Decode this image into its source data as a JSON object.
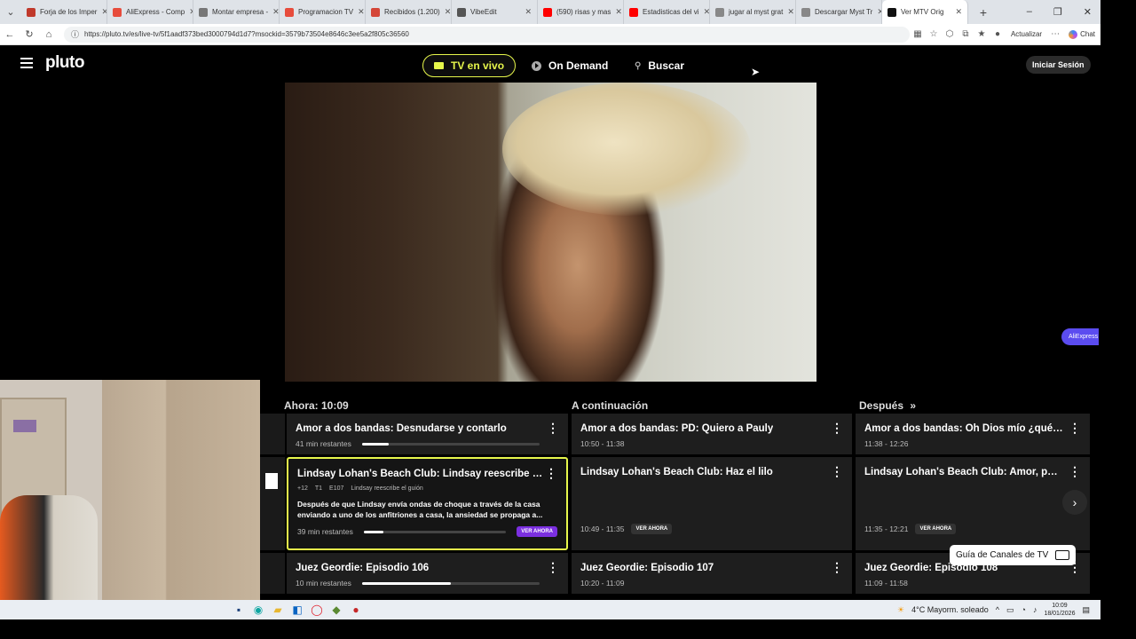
{
  "browser": {
    "tabs": [
      {
        "title": "Forja de los Imper",
        "color": "#c0392b"
      },
      {
        "title": "AliExpress - Comp",
        "color": "#e74c3c"
      },
      {
        "title": "Montar empresa -",
        "color": "#777777"
      },
      {
        "title": "Programacion TV",
        "color": "#e74c3c"
      },
      {
        "title": "Recibidos (1.200)",
        "color": "#d44638"
      },
      {
        "title": "VibeEdit",
        "color": "#555555"
      },
      {
        "title": "(590) risas y mas",
        "color": "#ff0000"
      },
      {
        "title": "Estadisticas del vi",
        "color": "#ff0000"
      },
      {
        "title": "jugar al myst grat",
        "color": "#888888"
      },
      {
        "title": "Descargar Myst Tr",
        "color": "#888888"
      },
      {
        "title": "Ver MTV Orig",
        "color": "#111111"
      }
    ],
    "new_tab": "+",
    "url": "https://pluto.tv/es/live-tv/5f1aadf373bed3000794d1d7?msockid=3579b73504e8646c3ee5a2f805c36560",
    "update_label": "Actualizar",
    "chat_label": "Chat"
  },
  "pluto": {
    "logo": "pluto",
    "nav": {
      "live_tv": "TV en vivo",
      "on_demand": "On Demand",
      "search": "Buscar"
    },
    "login": "Iniciar Sesión",
    "aliexpress_badge": "AliExpress",
    "guide": {
      "now_header": "Ahora: 10:09",
      "next_header": "A continuación",
      "later_header": "Después",
      "rows": [
        {
          "now": {
            "title": "Amor a dos bandas: Desnudarse y contarlo",
            "remaining": "41 min restantes",
            "progress": 0.15
          },
          "next": {
            "title": "Amor a dos bandas: PD: Quiero a Pauly",
            "time": "10:50 - 11:38"
          },
          "later": {
            "title": "Amor a dos bandas: Oh Dios mío ¿qué le ...",
            "time": "11:38 - 12:26"
          }
        },
        {
          "now": {
            "title": "Lindsay Lohan's Beach Club: Lindsay reescribe el...",
            "meta": [
              "+12",
              "T1",
              "E107",
              "Lindsay reescribe el guión"
            ],
            "desc": "Después de que Lindsay envía ondas de choque a través de la casa enviando a uno de los anfitriones a casa, la ansiedad se propaga a...",
            "remaining": "39 min restantes",
            "progress": 0.14,
            "cta": "VER AHORA"
          },
          "next": {
            "title": "Lindsay Lohan's Beach Club: Haz el lilo",
            "time": "10:49 - 11:35",
            "cta": "VER AHORA"
          },
          "later": {
            "title": "Lindsay Lohan's Beach Club: Amor, perdi...",
            "time": "11:35 - 12:21",
            "cta": "VER AHORA"
          }
        },
        {
          "now": {
            "title": "Juez Geordie: Episodio 106",
            "remaining": "10 min restantes",
            "progress": 0.5
          },
          "next": {
            "title": "Juez Geordie: Episodio 107",
            "time": "10:20 - 11:09"
          },
          "later": {
            "title": "Juez Geordie: Episodio 108",
            "time": "11:09 - 11:58"
          }
        }
      ],
      "channel_guide_button": "Guía de Canales de TV"
    }
  },
  "taskbar": {
    "weather": "4°C  Mayorm. soleado",
    "time": "10:09",
    "date": "18/01/2026"
  },
  "colors": {
    "accent": "#e6f64b",
    "cta": "#7b2fe0"
  }
}
